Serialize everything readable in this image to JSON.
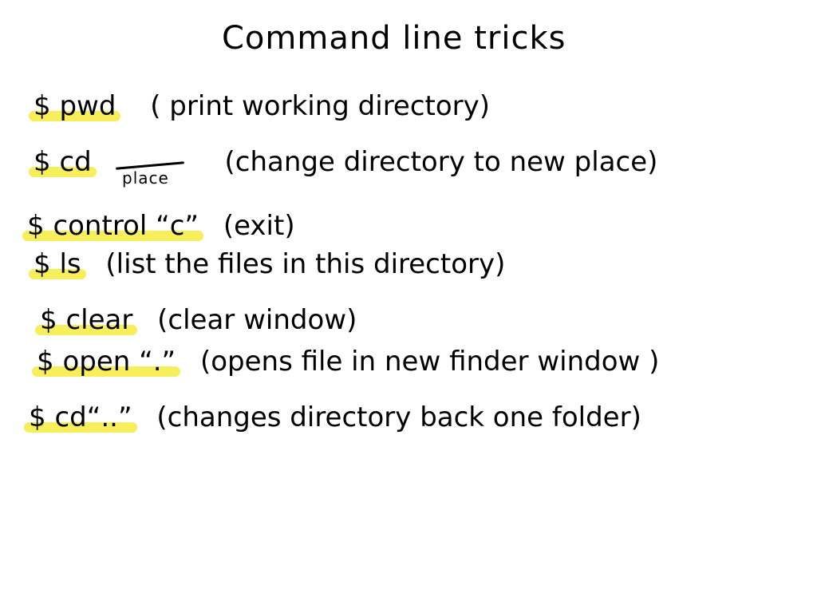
{
  "title": "Command line tricks",
  "highlight_color": "#f7ee5c",
  "rows": [
    {
      "command": "$ pwd",
      "description": "( print working directory)"
    },
    {
      "command": "$ cd",
      "description": "(change directory to new place)"
    },
    {
      "command": "$ control “c”",
      "description": "(exit)"
    },
    {
      "command": "$ ls",
      "description": "(list the files in this directory)"
    },
    {
      "command": "$ clear",
      "description": "(clear window)"
    },
    {
      "command": "$ open “.”",
      "description": "(opens file in new finder window )"
    },
    {
      "command": "$ cd“..”",
      "description": "(changes directory back one folder)"
    }
  ],
  "annotation": {
    "place_label": "place"
  }
}
